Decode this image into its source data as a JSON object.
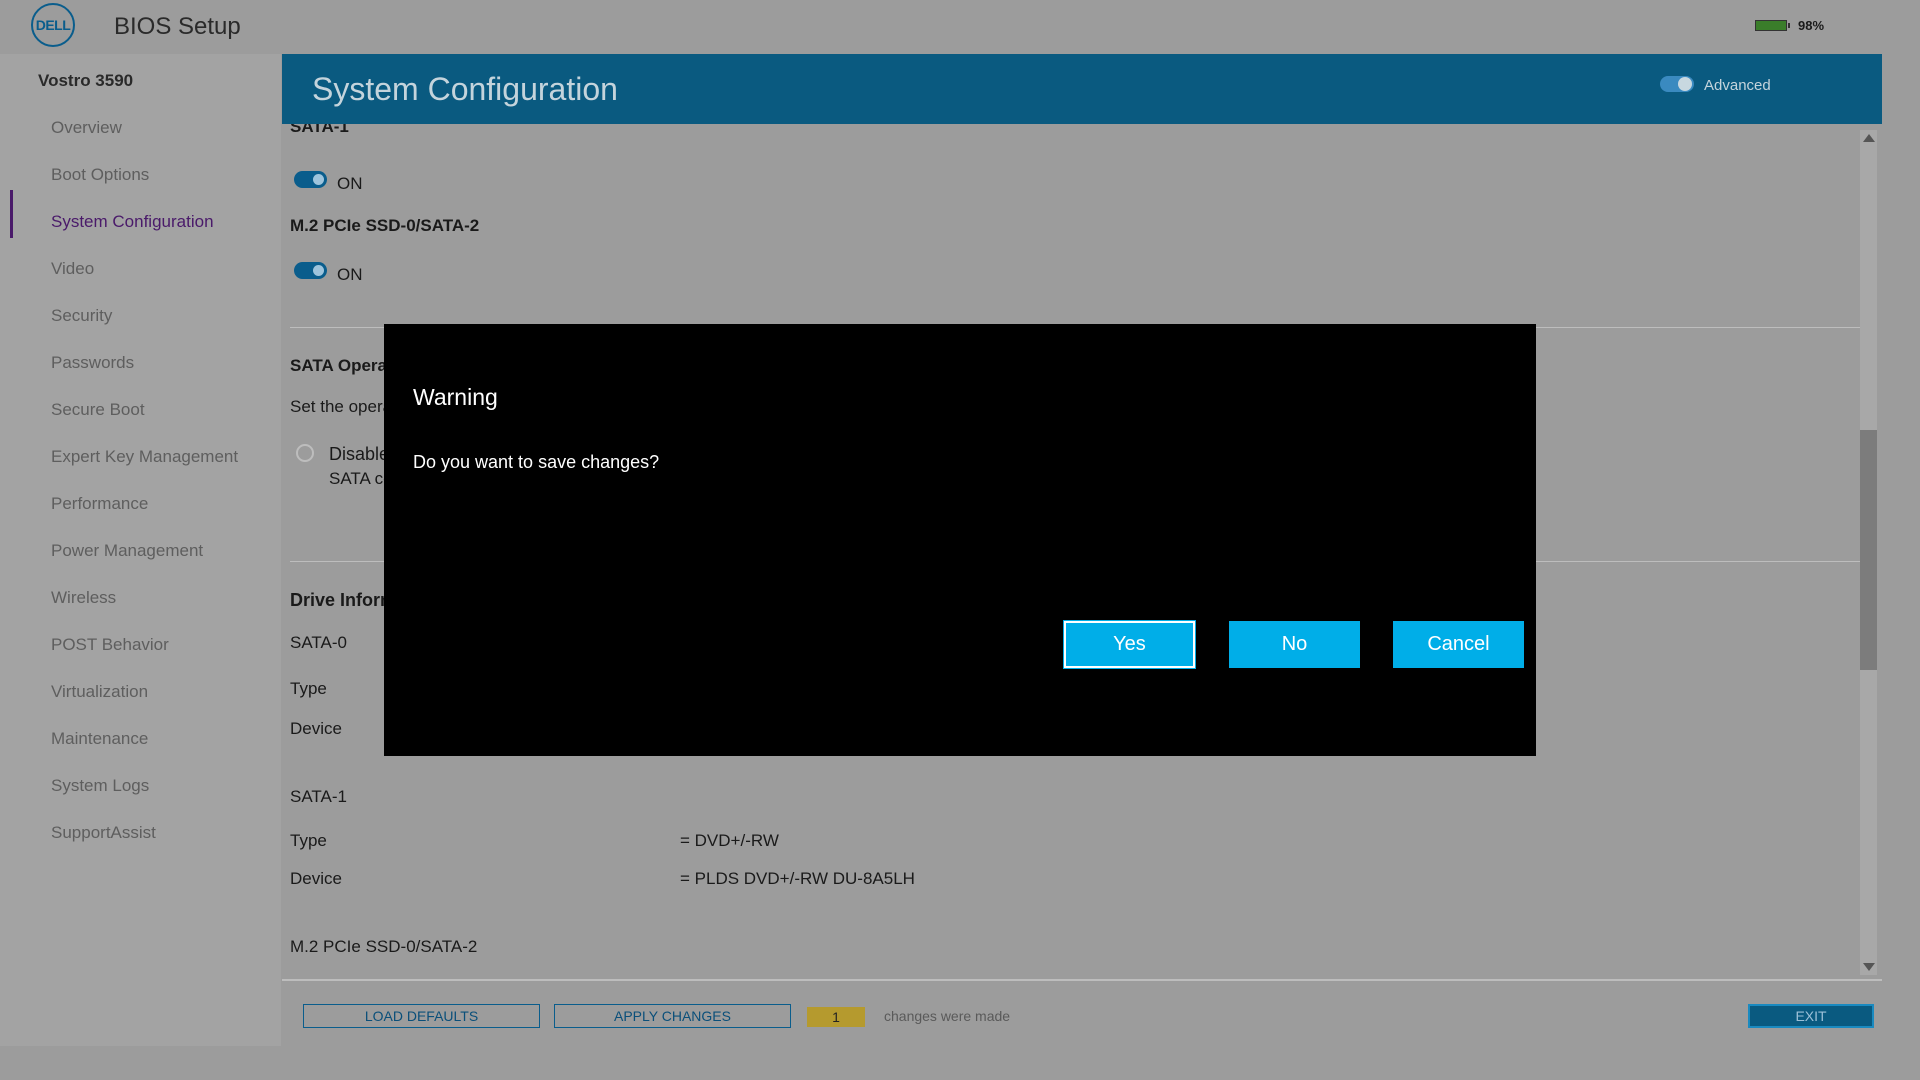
{
  "app": {
    "logo_text": "DELL",
    "title": "BIOS Setup",
    "battery_percent": "98%",
    "battery_level": 0.98
  },
  "sidebar": {
    "model": "Vostro 3590",
    "items": [
      {
        "label": "Overview"
      },
      {
        "label": "Boot Options"
      },
      {
        "label": "System Configuration",
        "active": true
      },
      {
        "label": "Video"
      },
      {
        "label": "Security"
      },
      {
        "label": "Passwords"
      },
      {
        "label": "Secure Boot"
      },
      {
        "label": "Expert Key Management"
      },
      {
        "label": "Performance"
      },
      {
        "label": "Power Management"
      },
      {
        "label": "Wireless"
      },
      {
        "label": "POST Behavior"
      },
      {
        "label": "Virtualization"
      },
      {
        "label": "Maintenance"
      },
      {
        "label": "System Logs"
      },
      {
        "label": "SupportAssist"
      }
    ]
  },
  "header": {
    "title": "System Configuration",
    "advanced_label": "Advanced",
    "advanced_on": true
  },
  "content": {
    "sata1_heading": "SATA-1",
    "sata1_toggle_label": "ON",
    "m2_heading": "M.2 PCIe SSD-0/SATA-2",
    "m2_toggle_label": "ON",
    "sata_operation_heading": "SATA Operation",
    "sata_operation_desc": "Set the operating mode of the integrated storage device controller.",
    "radio_disabled_label": "Disabled",
    "radio_disabled_desc": "SATA controllers are hidden",
    "drive_info_heading": "Drive Information",
    "drive0": {
      "name": "SATA-0",
      "type_label": "Type",
      "device_label": "Device"
    },
    "drive1": {
      "name": "SATA-1",
      "type_label": "Type",
      "type_value": "= DVD+/-RW",
      "device_label": "Device",
      "device_value": "= PLDS DVD+/-RW DU-8A5LH"
    },
    "drive2": {
      "name": "M.2 PCIe SSD-0/SATA-2"
    }
  },
  "footer": {
    "load_defaults": "LOAD DEFAULTS",
    "apply_changes": "APPLY CHANGES",
    "change_count": "1",
    "changes_text": "changes were made",
    "exit": "EXIT"
  },
  "dialog": {
    "title": "Warning",
    "message": "Do you want to save changes?",
    "yes": "Yes",
    "no": "No",
    "cancel": "Cancel"
  },
  "colors": {
    "header_bg": "#0a5a80",
    "dialog_button": "#00aee8",
    "active_nav": "#4a1a6a",
    "count_badge": "#b59a2e"
  }
}
